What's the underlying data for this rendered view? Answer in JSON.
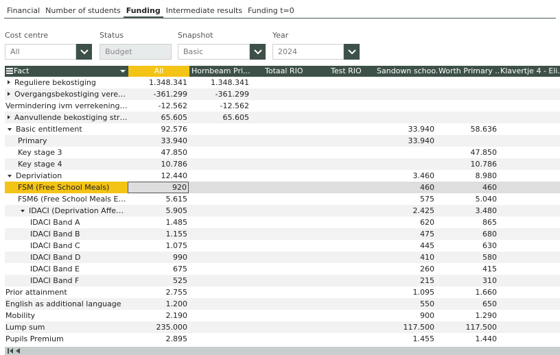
{
  "tabs": [
    "Financial",
    "Number of students",
    "Funding",
    "Intermediate results",
    "Funding t=0"
  ],
  "active_tab": 2,
  "filters": [
    {
      "label": "Cost centre",
      "value": "All"
    },
    {
      "label": "Status",
      "value": "Budget"
    },
    {
      "label": "Snapshot",
      "value": "Basic"
    },
    {
      "label": "Year",
      "value": "2024"
    }
  ],
  "columns": [
    "Fact",
    "All",
    "Hornbeam Pri...",
    "Totaal RIO",
    "Test RIO",
    "Sandown schoo...",
    "Worth Primary ...",
    "Klavertje 4 - Eli..."
  ],
  "rows": [
    {
      "label": "Reguliere bekostiging",
      "indent": 0,
      "expander": "collapsed",
      "values": [
        "1.348.341",
        "1.348.341",
        "",
        "",
        "",
        "",
        ""
      ]
    },
    {
      "label": "Overgangsbekostiging vereen...",
      "indent": 0,
      "expander": "collapsed",
      "values": [
        "-361.299",
        "-361.299",
        "",
        "",
        "",
        "",
        ""
      ]
    },
    {
      "label": "Vermindering ivm verrekening c...",
      "indent": 0,
      "expander": "none",
      "values": [
        "-12.562",
        "-12.562",
        "",
        "",
        "",
        "",
        ""
      ]
    },
    {
      "label": "Aanvullende bekostiging strat...",
      "indent": 0,
      "expander": "collapsed",
      "values": [
        "65.605",
        "65.605",
        "",
        "",
        "",
        "",
        ""
      ]
    },
    {
      "label": "Basic entitlement",
      "indent": 0,
      "expander": "expanded",
      "values": [
        "92.576",
        "",
        "",
        "",
        "33.940",
        "58.636",
        ""
      ]
    },
    {
      "label": "Primary",
      "indent": 1,
      "expander": "none",
      "values": [
        "33.940",
        "",
        "",
        "",
        "33.940",
        "",
        ""
      ]
    },
    {
      "label": "Key stage 3",
      "indent": 1,
      "expander": "none",
      "values": [
        "47.850",
        "",
        "",
        "",
        "",
        "47.850",
        ""
      ]
    },
    {
      "label": "Key stage 4",
      "indent": 1,
      "expander": "none",
      "values": [
        "10.786",
        "",
        "",
        "",
        "",
        "10.786",
        ""
      ]
    },
    {
      "label": "Depriviation",
      "indent": 0,
      "expander": "expanded",
      "values": [
        "12.440",
        "",
        "",
        "",
        "3.460",
        "8.980",
        ""
      ]
    },
    {
      "label": "FSM (Free School Meals)",
      "indent": 1,
      "expander": "none",
      "selected": true,
      "values": [
        "920",
        "",
        "",
        "",
        "460",
        "460",
        ""
      ]
    },
    {
      "label": "FSM6 (Free School Meals Eve...",
      "indent": 1,
      "expander": "none",
      "values": [
        "5.615",
        "",
        "",
        "",
        "575",
        "5.040",
        ""
      ]
    },
    {
      "label": "IDACI (Deprivation Affecti...",
      "indent": 1,
      "expander": "expanded",
      "values": [
        "5.905",
        "",
        "",
        "",
        "2.425",
        "3.480",
        ""
      ]
    },
    {
      "label": "IDACI Band A",
      "indent": 2,
      "expander": "none",
      "values": [
        "1.485",
        "",
        "",
        "",
        "620",
        "865",
        ""
      ]
    },
    {
      "label": "IDACI Band B",
      "indent": 2,
      "expander": "none",
      "values": [
        "1.155",
        "",
        "",
        "",
        "475",
        "680",
        ""
      ]
    },
    {
      "label": "IDACI Band C",
      "indent": 2,
      "expander": "none",
      "values": [
        "1.075",
        "",
        "",
        "",
        "445",
        "630",
        ""
      ]
    },
    {
      "label": "IDACI Band D",
      "indent": 2,
      "expander": "none",
      "values": [
        "990",
        "",
        "",
        "",
        "410",
        "580",
        ""
      ]
    },
    {
      "label": "IDACI Band E",
      "indent": 2,
      "expander": "none",
      "values": [
        "675",
        "",
        "",
        "",
        "260",
        "415",
        ""
      ]
    },
    {
      "label": "IDACI Band F",
      "indent": 2,
      "expander": "none",
      "values": [
        "525",
        "",
        "",
        "",
        "215",
        "310",
        ""
      ]
    },
    {
      "label": "Prior attainment",
      "indent": 0,
      "expander": "none",
      "values": [
        "2.755",
        "",
        "",
        "",
        "1.095",
        "1.660",
        ""
      ]
    },
    {
      "label": "English as additional language",
      "indent": 0,
      "expander": "none",
      "values": [
        "1.200",
        "",
        "",
        "",
        "550",
        "650",
        ""
      ]
    },
    {
      "label": "Mobility",
      "indent": 0,
      "expander": "none",
      "values": [
        "2.190",
        "",
        "",
        "",
        "900",
        "1.290",
        ""
      ]
    },
    {
      "label": "Lump sum",
      "indent": 0,
      "expander": "none",
      "values": [
        "235.000",
        "",
        "",
        "",
        "117.500",
        "117.500",
        ""
      ]
    },
    {
      "label": "Pupils Premium",
      "indent": 0,
      "expander": "none",
      "values": [
        "2.895",
        "",
        "",
        "",
        "1.455",
        "1.440",
        ""
      ]
    }
  ],
  "colors": {
    "header": "#3d5148",
    "accent": "#f3c315",
    "stripe": "#f2f2f2",
    "selected_row": "#dedede"
  }
}
